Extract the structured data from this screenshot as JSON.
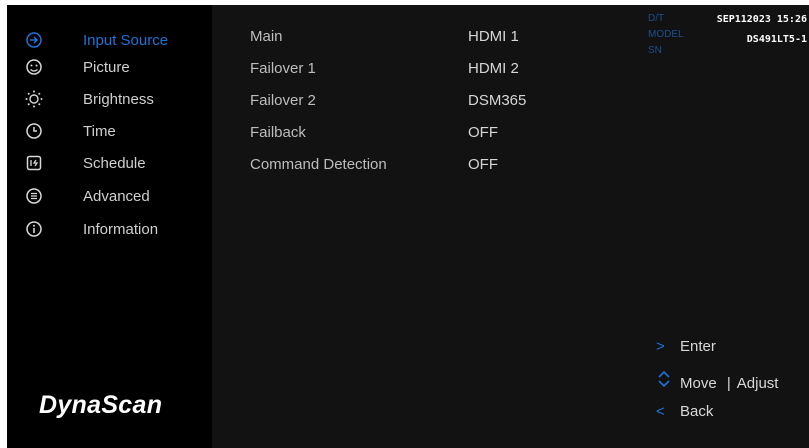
{
  "sidebar": {
    "items": [
      {
        "label": "Input Source",
        "icon": "input-source-icon",
        "active": true
      },
      {
        "label": "Picture",
        "icon": "picture-icon"
      },
      {
        "label": "Brightness",
        "icon": "brightness-icon"
      },
      {
        "label": "Time",
        "icon": "clock-icon"
      },
      {
        "label": "Schedule",
        "icon": "schedule-icon"
      },
      {
        "label": "Advanced",
        "icon": "advanced-icon"
      },
      {
        "label": "Information",
        "icon": "information-icon"
      }
    ],
    "logo": "DynaScan"
  },
  "settings": {
    "rows": [
      {
        "label": "Main",
        "value": "HDMI 1"
      },
      {
        "label": "Failover 1",
        "value": "HDMI 2"
      },
      {
        "label": "Failover 2",
        "value": "DSM365"
      },
      {
        "label": "Failback",
        "value": "OFF"
      },
      {
        "label": "Command Detection",
        "value": "OFF"
      }
    ]
  },
  "info": {
    "dt_label": "D/T",
    "model_label": "MODEL",
    "sn_label": "SN",
    "dt_value": "SEP112023 15:26",
    "model_value": "DS491LT5-1"
  },
  "hints": {
    "enter": "Enter",
    "move": "Move",
    "separator": "|",
    "adjust": "Adjust",
    "back": "Back"
  },
  "colors": {
    "accent": "#1e73d8",
    "sidebar_bg": "#000000",
    "panel_bg": "#121212"
  }
}
